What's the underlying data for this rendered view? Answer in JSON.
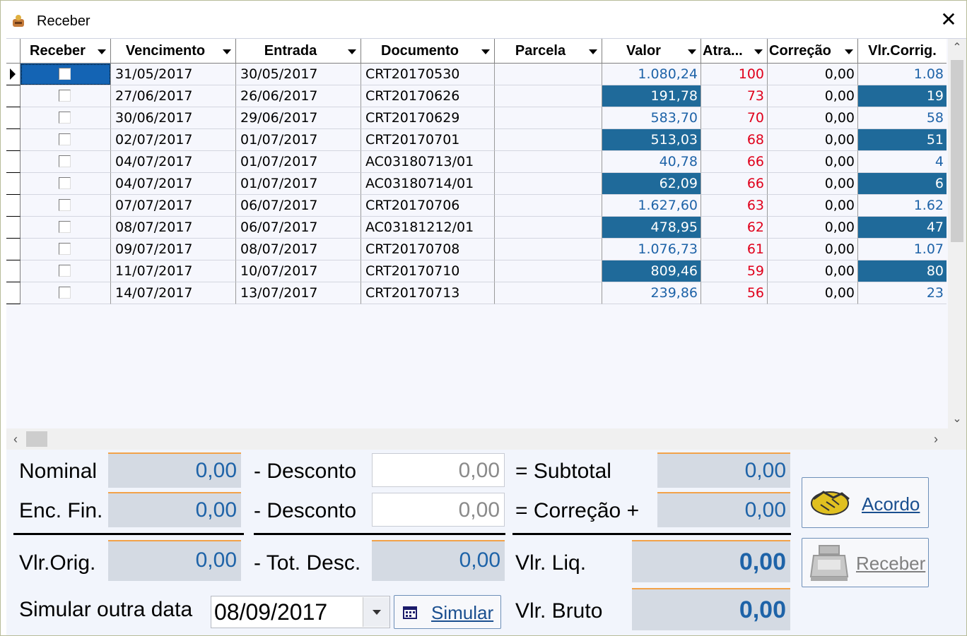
{
  "window": {
    "title": "Receber",
    "close_glyph": "✕"
  },
  "grid": {
    "columns": [
      "Receber",
      "Vencimento",
      "Entrada",
      "Documento",
      "Parcela",
      "Valor",
      "Atra...",
      "Correção",
      "Vlr.Corrig."
    ],
    "rows": [
      {
        "venc": "31/05/2017",
        "entrada": "30/05/2017",
        "doc": "CRT20170530",
        "parcela": "",
        "valor": "1.080,24",
        "atraso": "100",
        "correcao": "0,00",
        "corrig": "1.08"
      },
      {
        "venc": "27/06/2017",
        "entrada": "26/06/2017",
        "doc": "CRT20170626",
        "parcela": "",
        "valor": "191,78",
        "atraso": "73",
        "correcao": "0,00",
        "corrig": "19"
      },
      {
        "venc": "30/06/2017",
        "entrada": "29/06/2017",
        "doc": "CRT20170629",
        "parcela": "",
        "valor": "583,70",
        "atraso": "70",
        "correcao": "0,00",
        "corrig": "58"
      },
      {
        "venc": "02/07/2017",
        "entrada": "01/07/2017",
        "doc": "CRT20170701",
        "parcela": "",
        "valor": "513,03",
        "atraso": "68",
        "correcao": "0,00",
        "corrig": "51"
      },
      {
        "venc": "04/07/2017",
        "entrada": "01/07/2017",
        "doc": "AC03180713/01",
        "parcela": "",
        "valor": "40,78",
        "atraso": "66",
        "correcao": "0,00",
        "corrig": "4"
      },
      {
        "venc": "04/07/2017",
        "entrada": "01/07/2017",
        "doc": "AC03180714/01",
        "parcela": "",
        "valor": "62,09",
        "atraso": "66",
        "correcao": "0,00",
        "corrig": "6"
      },
      {
        "venc": "07/07/2017",
        "entrada": "06/07/2017",
        "doc": "CRT20170706",
        "parcela": "",
        "valor": "1.627,60",
        "atraso": "63",
        "correcao": "0,00",
        "corrig": "1.62"
      },
      {
        "venc": "08/07/2017",
        "entrada": "06/07/2017",
        "doc": "AC03181212/01",
        "parcela": "",
        "valor": "478,95",
        "atraso": "62",
        "correcao": "0,00",
        "corrig": "47"
      },
      {
        "venc": "09/07/2017",
        "entrada": "08/07/2017",
        "doc": "CRT20170708",
        "parcela": "",
        "valor": "1.076,73",
        "atraso": "61",
        "correcao": "0,00",
        "corrig": "1.07"
      },
      {
        "venc": "11/07/2017",
        "entrada": "10/07/2017",
        "doc": "CRT20170710",
        "parcela": "",
        "valor": "809,46",
        "atraso": "59",
        "correcao": "0,00",
        "corrig": "80"
      },
      {
        "venc": "14/07/2017",
        "entrada": "13/07/2017",
        "doc": "CRT20170713",
        "parcela": "",
        "valor": "239,86",
        "atraso": "56",
        "correcao": "0,00",
        "corrig": "23"
      }
    ]
  },
  "summary": {
    "nominal_label": "Nominal",
    "nominal": "0,00",
    "desconto1_label": "- Desconto",
    "desconto1": "0,00",
    "subtotal_label": "= Subtotal",
    "subtotal": "0,00",
    "encfin_label": "Enc. Fin.",
    "encfin": "0,00",
    "desconto2_label": "- Desconto",
    "desconto2": "0,00",
    "correcao_label": "= Correção  +",
    "correcao": "0,00",
    "vlrorig_label": "Vlr.Orig.",
    "vlrorig": "0,00",
    "totdesc_label": "- Tot. Desc.",
    "totdesc": "0,00",
    "vlrliq_label": "Vlr. Liq.",
    "vlrliq": "0,00",
    "simular_label": "Simular outra data",
    "simular_date": "08/09/2017",
    "simular_button": "Simular",
    "vlrbruto_label": "Vlr. Bruto",
    "vlrbruto": "0,00"
  },
  "buttons": {
    "acordo": "Acordo",
    "receber": "Receber"
  },
  "icons": {
    "app": "hand-money-icon",
    "handshake": "handshake-icon",
    "register": "cash-register-icon",
    "calendar": "calendar-icon"
  }
}
